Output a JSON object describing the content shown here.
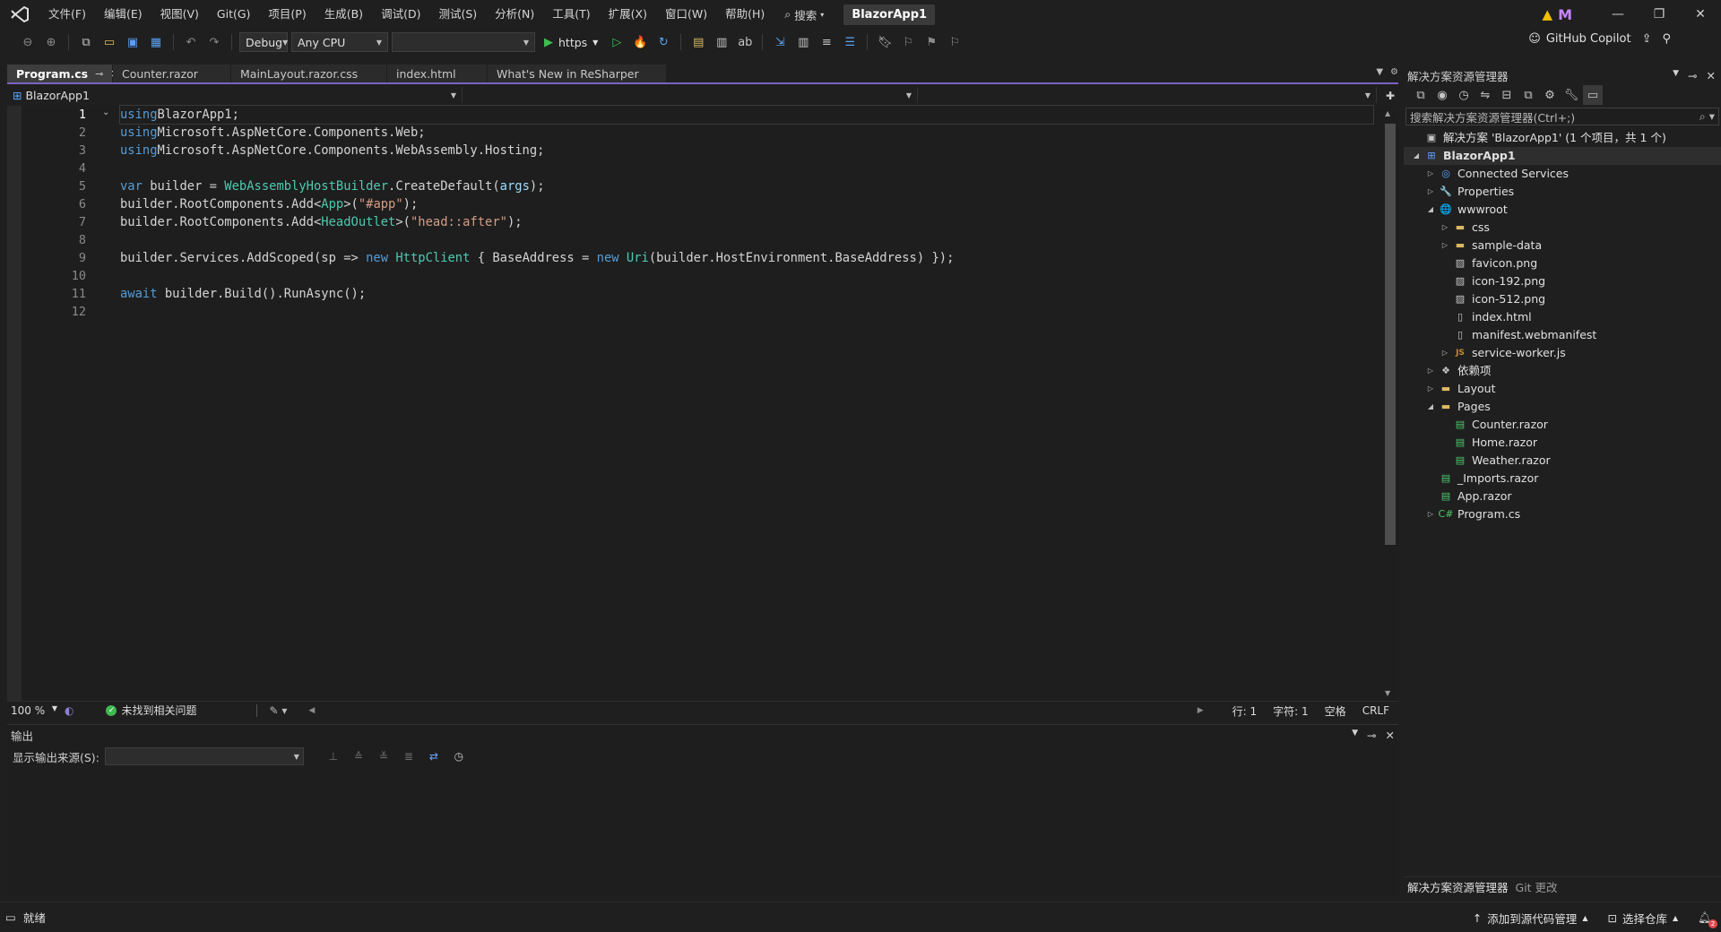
{
  "menu": {
    "items": [
      "文件(F)",
      "编辑(E)",
      "视图(V)",
      "Git(G)",
      "项目(P)",
      "生成(B)",
      "调试(D)",
      "测试(S)",
      "分析(N)",
      "工具(T)",
      "扩展(X)",
      "窗口(W)",
      "帮助(H)"
    ],
    "search_label": "搜索",
    "app_title": "BlazorApp1",
    "avatar_initial": "M"
  },
  "toolbar": {
    "configuration": "Debug",
    "platform": "Any CPU",
    "startup_item": "",
    "run_profile": "https",
    "copilot_label": "GitHub Copilot"
  },
  "tabs": [
    {
      "label": "Program.cs",
      "active": true
    },
    {
      "label": "Counter.razor",
      "active": false
    },
    {
      "label": "MainLayout.razor.css",
      "active": false
    },
    {
      "label": "index.html",
      "active": false
    },
    {
      "label": "What's New in ReSharper",
      "active": false
    }
  ],
  "navbar": {
    "project": "BlazorApp1",
    "type": "",
    "member": ""
  },
  "editor": {
    "current_line": 1,
    "lines": [
      [
        [
          "kw",
          "using"
        ],
        [
          "",
          "BlazorApp1;"
        ]
      ],
      [
        [
          "kw",
          "using"
        ],
        [
          "",
          "Microsoft.AspNetCore.Components.Web;"
        ]
      ],
      [
        [
          "kw",
          "using"
        ],
        [
          "",
          "Microsoft.AspNetCore.Components.WebAssembly.Hosting;"
        ]
      ],
      [],
      [
        [
          "kw",
          "var"
        ],
        [
          "",
          " builder = "
        ],
        [
          "ty",
          "WebAssemblyHostBuilder"
        ],
        [
          "",
          ".CreateDefault("
        ],
        [
          "prm",
          "args"
        ],
        [
          "",
          ");"
        ]
      ],
      [
        [
          "",
          "builder.RootComponents.Add<"
        ],
        [
          "ty",
          "App"
        ],
        [
          "",
          ">("
        ],
        [
          "str",
          "\"#app\""
        ],
        [
          "",
          ");"
        ]
      ],
      [
        [
          "",
          "builder.RootComponents.Add<"
        ],
        [
          "ty",
          "HeadOutlet"
        ],
        [
          "",
          ">("
        ],
        [
          "str",
          "\"head::after\""
        ],
        [
          "",
          ");"
        ]
      ],
      [],
      [
        [
          "",
          "builder.Services.AddScoped(sp => "
        ],
        [
          "kw",
          "new"
        ],
        [
          "",
          " "
        ],
        [
          "ty",
          "HttpClient"
        ],
        [
          "",
          " { BaseAddress = "
        ],
        [
          "kw",
          "new"
        ],
        [
          "",
          " "
        ],
        [
          "ty",
          "Uri"
        ],
        [
          "",
          "(builder.HostEnvironment.BaseAddress) });"
        ]
      ],
      [],
      [
        [
          "kw",
          "await"
        ],
        [
          "",
          " builder.Build().RunAsync();"
        ]
      ],
      []
    ]
  },
  "editor_status": {
    "zoom": "100 %",
    "issues": "未找到相关问题",
    "line": "行: 1",
    "char": "字符: 1",
    "spacing": "空格",
    "line_ending": "CRLF"
  },
  "output": {
    "title": "输出",
    "source_label": "显示输出来源(S):",
    "source_value": ""
  },
  "solution_explorer": {
    "title": "解决方案资源管理器",
    "search_placeholder": "搜索解决方案资源管理器(Ctrl+;)",
    "tree": [
      {
        "depth": 0,
        "caret": "",
        "icon": "solution-icon",
        "glyph": "▣",
        "cls": "file",
        "label": "解决方案 'BlazorApp1' (1 个项目，共 1 个)",
        "bold": false
      },
      {
        "depth": 0,
        "caret": "◢",
        "icon": "project-icon",
        "glyph": "⊞",
        "cls": "blue",
        "label": "BlazorApp1",
        "bold": true,
        "selected": true
      },
      {
        "depth": 1,
        "caret": "▷",
        "icon": "connected-services-icon",
        "glyph": "◎",
        "cls": "blue",
        "label": "Connected Services"
      },
      {
        "depth": 1,
        "caret": "▷",
        "icon": "properties-icon",
        "glyph": "🔧",
        "cls": "folder",
        "label": "Properties"
      },
      {
        "depth": 1,
        "caret": "◢",
        "icon": "globe-icon",
        "glyph": "🌐",
        "cls": "blue",
        "label": "wwwroot"
      },
      {
        "depth": 2,
        "caret": "▷",
        "icon": "folder-icon",
        "glyph": "▬",
        "cls": "folder",
        "label": "css"
      },
      {
        "depth": 2,
        "caret": "▷",
        "icon": "folder-icon",
        "glyph": "▬",
        "cls": "folder",
        "label": "sample-data"
      },
      {
        "depth": 2,
        "caret": "",
        "icon": "image-file-icon",
        "glyph": "▨",
        "cls": "file",
        "label": "favicon.png"
      },
      {
        "depth": 2,
        "caret": "",
        "icon": "image-file-icon",
        "glyph": "▨",
        "cls": "file",
        "label": "icon-192.png"
      },
      {
        "depth": 2,
        "caret": "",
        "icon": "image-file-icon",
        "glyph": "▨",
        "cls": "file",
        "label": "icon-512.png"
      },
      {
        "depth": 2,
        "caret": "",
        "icon": "html-file-icon",
        "glyph": "▯",
        "cls": "file",
        "label": "index.html"
      },
      {
        "depth": 2,
        "caret": "",
        "icon": "manifest-file-icon",
        "glyph": "▯",
        "cls": "file",
        "label": "manifest.webmanifest"
      },
      {
        "depth": 2,
        "caret": "▷",
        "icon": "js-file-icon",
        "glyph": "JS",
        "cls": "js",
        "label": "service-worker.js"
      },
      {
        "depth": 1,
        "caret": "▷",
        "icon": "dependencies-icon",
        "glyph": "❖",
        "cls": "file",
        "label": "依赖项"
      },
      {
        "depth": 1,
        "caret": "▷",
        "icon": "folder-icon",
        "glyph": "▬",
        "cls": "folder",
        "label": "Layout"
      },
      {
        "depth": 1,
        "caret": "◢",
        "icon": "folder-open-icon",
        "glyph": "▬",
        "cls": "folder",
        "label": "Pages"
      },
      {
        "depth": 2,
        "caret": "",
        "icon": "razor-file-icon",
        "glyph": "▤",
        "cls": "green",
        "label": "Counter.razor"
      },
      {
        "depth": 2,
        "caret": "",
        "icon": "razor-file-icon",
        "glyph": "▤",
        "cls": "green",
        "label": "Home.razor"
      },
      {
        "depth": 2,
        "caret": "",
        "icon": "razor-file-icon",
        "glyph": "▤",
        "cls": "green",
        "label": "Weather.razor"
      },
      {
        "depth": 1,
        "caret": "",
        "icon": "razor-file-icon",
        "glyph": "▤",
        "cls": "green",
        "label": "_Imports.razor"
      },
      {
        "depth": 1,
        "caret": "",
        "icon": "razor-file-icon",
        "glyph": "▤",
        "cls": "green",
        "label": "App.razor"
      },
      {
        "depth": 1,
        "caret": "▷",
        "icon": "csharp-file-icon",
        "glyph": "C#",
        "cls": "green",
        "label": "Program.cs"
      }
    ],
    "bottom_tabs": [
      "解决方案资源管理器",
      "Git 更改"
    ]
  },
  "statusbar": {
    "ready": "就绪",
    "add_source_control": "添加到源代码管理",
    "select_repo": "选择仓库",
    "notification_count": "2"
  },
  "colors": {
    "accent": "#7c62c4",
    "keyword": "#569cd6",
    "type": "#4ec9b0",
    "string": "#d69d85",
    "parameter": "#9cdcfe"
  }
}
